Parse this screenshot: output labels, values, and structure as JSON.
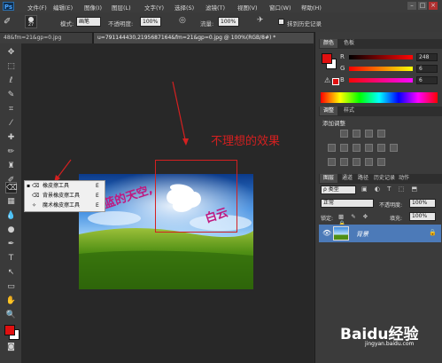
{
  "app": {
    "logo": "Ps"
  },
  "menu": [
    "文件(F)",
    "编辑(E)",
    "图像(I)",
    "图层(L)",
    "文字(Y)",
    "选择(S)",
    "滤镜(T)",
    "视图(V)",
    "窗口(W)",
    "帮助(H)"
  ],
  "window_buttons": [
    "–",
    "□",
    "×"
  ],
  "options": {
    "brush_size": "27",
    "mode_label": "模式:",
    "mode_value": "画笔",
    "opacity_label": "不透明度:",
    "opacity_value": "100%",
    "flow_label": "流量:",
    "flow_value": "100%",
    "history_label": "抹到历史记录"
  },
  "tabs": [
    {
      "label": "48&fm=21&gp=0.jpg"
    },
    {
      "label": "u=791144430,2195687164&fm=21&gp=0.jpg @ 100%(RGB/8#) *"
    }
  ],
  "flyout": {
    "items": [
      {
        "label": "橡皮擦工具",
        "shortcut": "E"
      },
      {
        "label": "背景橡皮擦工具",
        "shortcut": "E"
      },
      {
        "label": "魔术橡皮擦工具",
        "shortcut": "E"
      }
    ]
  },
  "canvas": {
    "photo_text": "蓝蓝的天空,",
    "photo_text_right": "白云",
    "annotation": "不理想的效果"
  },
  "color_panel": {
    "tabs": [
      "颜色",
      "色板"
    ],
    "r_label": "R",
    "r_value": "248",
    "g_label": "G",
    "g_value": "6",
    "b_label": "B",
    "b_value": "6"
  },
  "adjust_panel": {
    "tabs": [
      "调整",
      "样式"
    ],
    "title": "添加调整"
  },
  "layers_panel": {
    "tabs": [
      "图层",
      "通道",
      "路径",
      "历史记录",
      "动作"
    ],
    "filter_label": "ρ 类型",
    "blend_mode": "正常",
    "opacity_label": "不透明度:",
    "opacity_value": "100%",
    "lock_label": "锁定:",
    "fill_label": "填充:",
    "fill_value": "100%",
    "layer_name": "背景"
  },
  "watermark": {
    "brand": "Baidu经验",
    "sub": "jingyan.baidu.com"
  },
  "colors": {
    "foreground": "#e01010",
    "background": "#ffffff",
    "annotation": "#d42020"
  }
}
